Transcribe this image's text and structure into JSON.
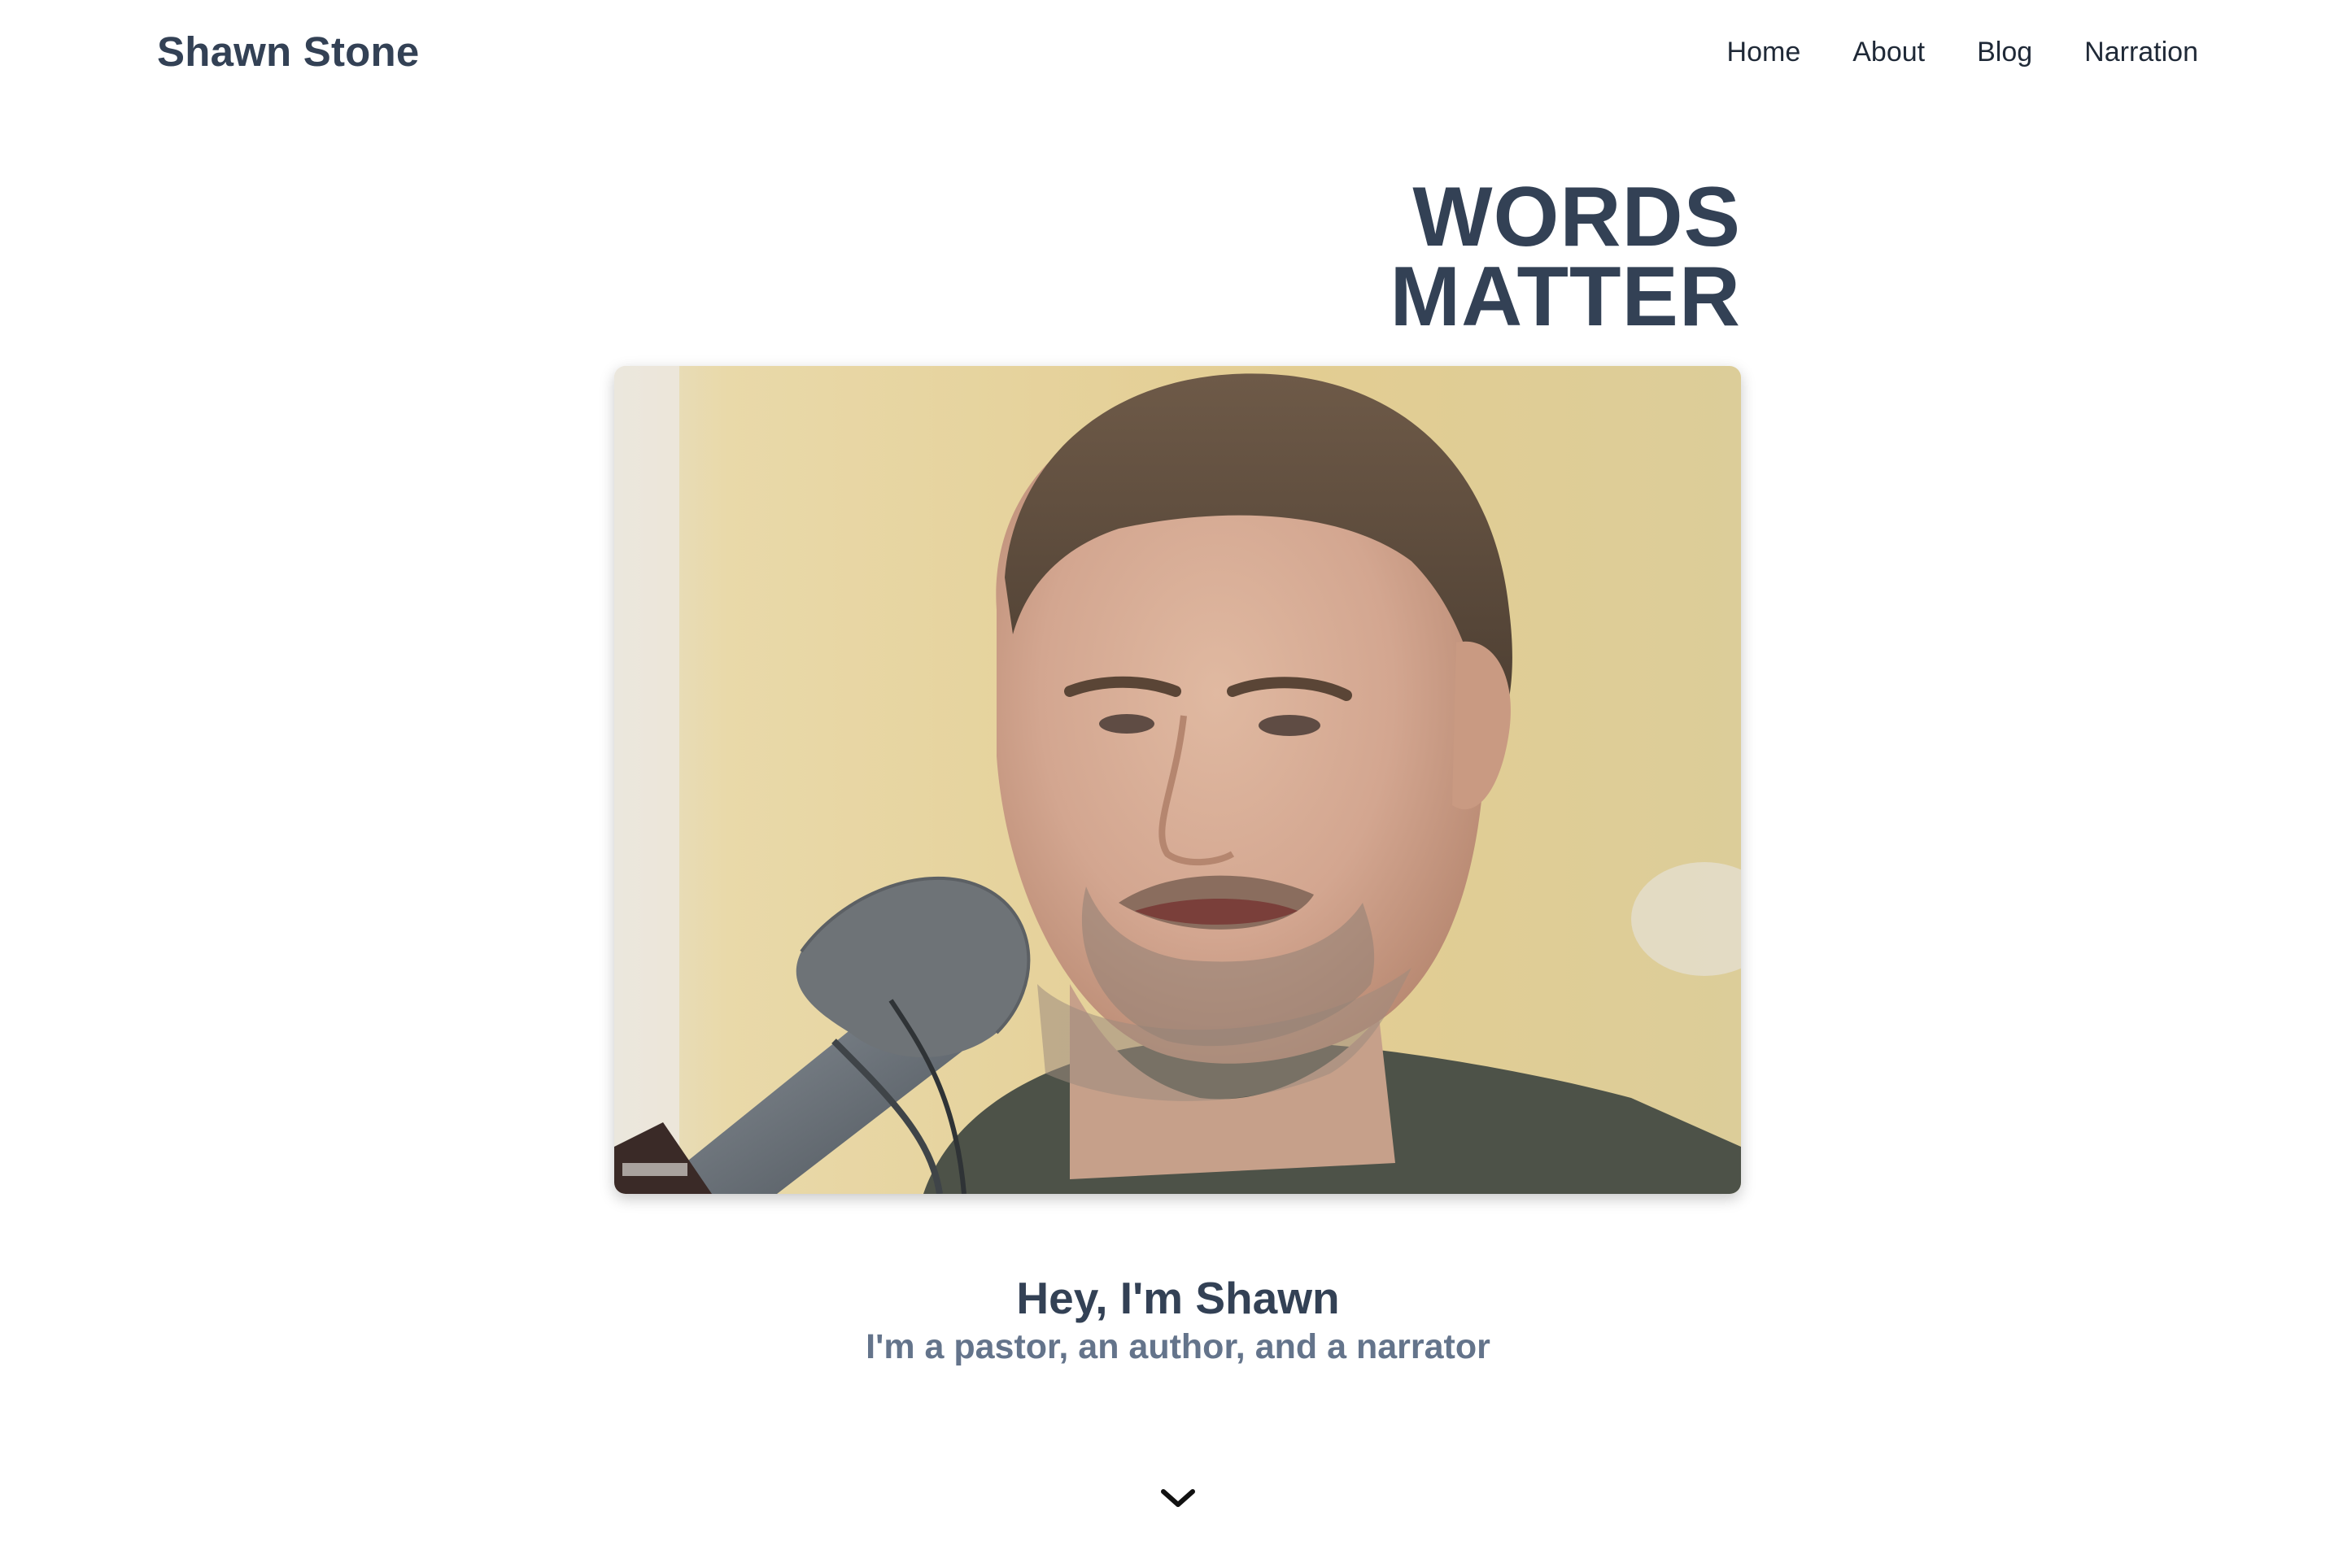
{
  "header": {
    "brand": "Shawn Stone",
    "nav": [
      "Home",
      "About",
      "Blog",
      "Narration"
    ]
  },
  "hero": {
    "headline_line1": "WORDS",
    "headline_line2": "MATTER",
    "photo_icon": "portrait-photo-icon"
  },
  "intro": {
    "title": "Hey, I'm Shawn",
    "subtitle": "I'm a pastor, an author, and a narrator"
  },
  "scroll": {
    "icon": "chevron-down-icon"
  },
  "colors": {
    "heading": "#334155",
    "subtitle": "#64748b",
    "nav": "#1f2937",
    "background": "#ffffff"
  }
}
